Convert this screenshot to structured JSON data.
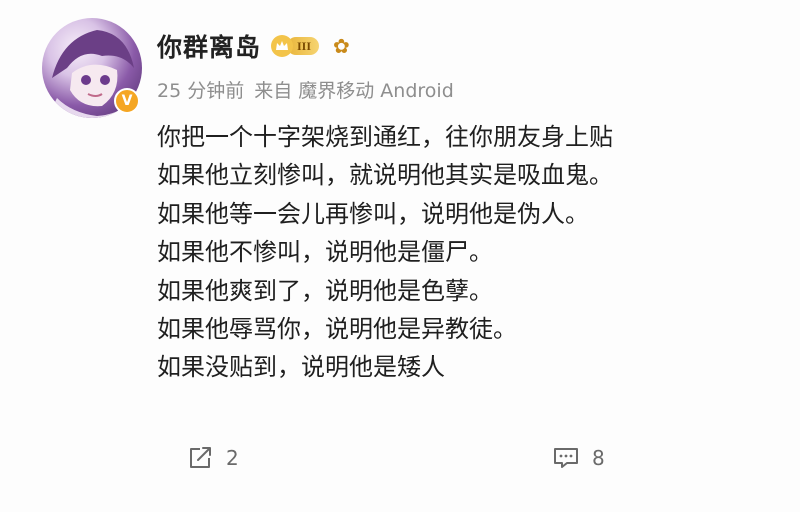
{
  "post": {
    "username": "你群离岛",
    "level": "III",
    "time": "25 分钟前",
    "source": "来自 魔界移动 Android",
    "lines": [
      "你把一个十字架烧到通红，往你朋友身上贴",
      "如果他立刻惨叫，就说明他其实是吸血鬼。",
      "如果他等一会儿再惨叫，说明他是伪人。",
      "如果他不惨叫，说明他是僵尸。",
      "如果他爽到了，说明他是色孽。",
      "如果他辱骂你，说明他是异教徒。",
      "如果没贴到，说明他是矮人"
    ],
    "share_count": "2",
    "comment_count": "8"
  },
  "icons": {
    "avatar": "avatar-image",
    "verified": "verified-badge-icon",
    "crown": "crown-icon",
    "flower": "flower-icon",
    "share": "share-icon",
    "comment": "comment-icon"
  },
  "colors": {
    "verified_badge": "#f5a623",
    "level_badge": "#e9b53a",
    "meta_text": "#8e8e8e",
    "body_text": "#1f1f1f"
  }
}
